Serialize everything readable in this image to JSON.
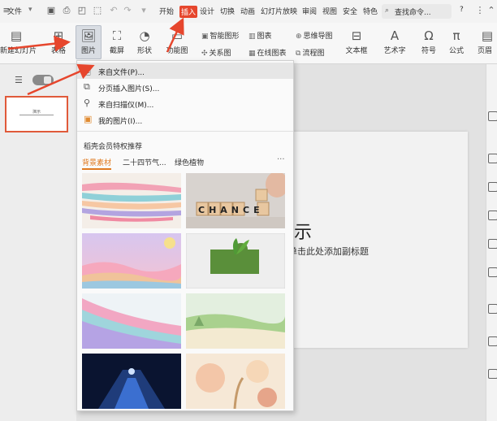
{
  "menubar": {
    "file": "文件",
    "tabs": [
      "开始",
      "插入",
      "设计",
      "切换",
      "动画",
      "幻灯片放映",
      "审阅",
      "视图",
      "安全",
      "特色"
    ],
    "search": "查找命令...",
    "help": "?"
  },
  "ribbon": {
    "new_slide": "新建幻灯片",
    "table": "表格",
    "picture": "图片",
    "screenshot": "截屏",
    "shape": "形状",
    "function_chart": "功能图",
    "smart_graphic": "智能图形",
    "chart": "图表",
    "mind_map": "思维导图",
    "relation_map": "关系图",
    "online_chart": "在线图表",
    "flowchart": "流程图",
    "textbox": "文本框",
    "wordart": "艺术字",
    "symbol": "符号",
    "formula": "公式",
    "header_footer": "页眉"
  },
  "slide": {
    "title": "演示",
    "subtitle": "单击此处添加副标题"
  },
  "dropdown": {
    "items": [
      "来自文件(P)...",
      "分页插入图片(S)...",
      "来自扫描仪(M)...",
      "我的图片(I)..."
    ],
    "recommend_title": "稻壳会员特权推荐",
    "categories": [
      "背景素材",
      "二十四节气...",
      "绿色植物"
    ],
    "more": "···",
    "chance_text": "CHANCE"
  },
  "colors": {
    "accent": "#e6462d",
    "category_active": "#e07a20"
  }
}
